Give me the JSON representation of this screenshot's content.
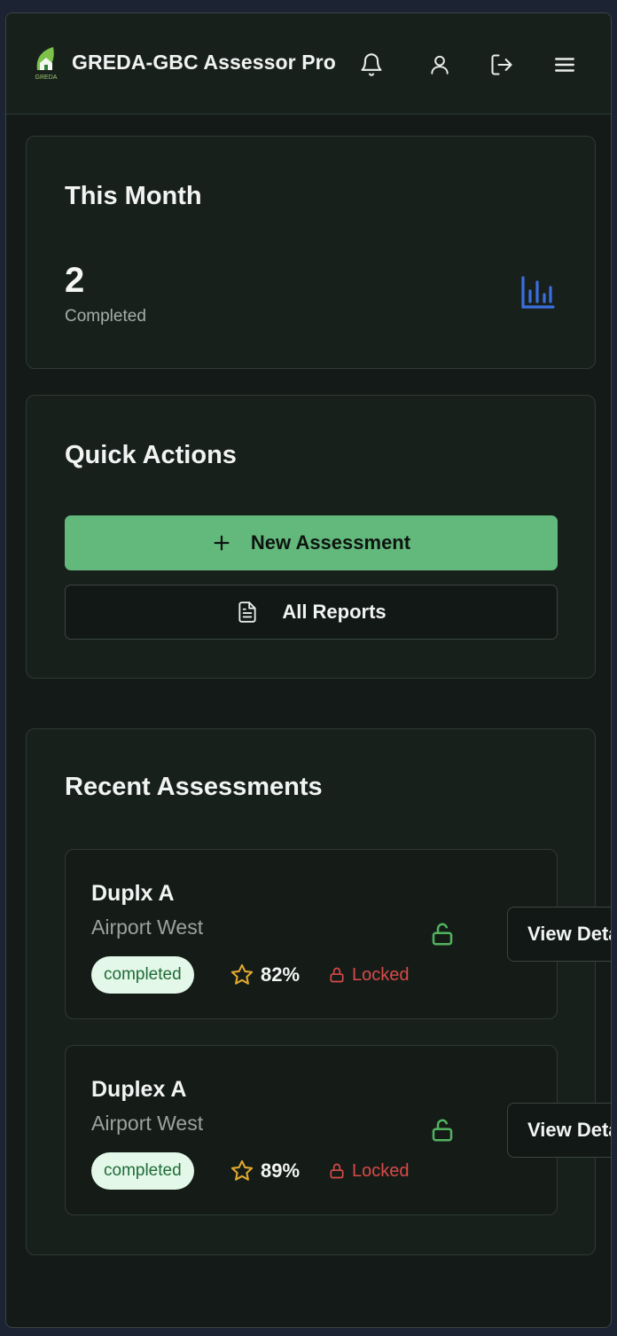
{
  "header": {
    "app_title": "GREDA-GBC Assessor Pro",
    "logo_text": "GREDA",
    "icons": [
      "bell-icon",
      "user-icon",
      "logout-icon",
      "menu-icon"
    ]
  },
  "this_month": {
    "title": "This Month",
    "value": "2",
    "label": "Completed",
    "icon": "bar-chart-icon"
  },
  "quick_actions": {
    "title": "Quick Actions",
    "new_assessment_label": "New Assessment",
    "all_reports_label": "All Reports"
  },
  "recent": {
    "title": "Recent Assessments",
    "items": [
      {
        "name": "Duplx A",
        "location": "Airport West",
        "status": "completed",
        "score": "82%",
        "lock_label": "Locked",
        "view_label": "View Details"
      },
      {
        "name": "Duplex A",
        "location": "Airport West",
        "status": "completed",
        "score": "89%",
        "lock_label": "Locked",
        "view_label": "View Details"
      }
    ]
  },
  "colors": {
    "accent_green": "#63b87c",
    "chart_blue": "#3b6fe0",
    "star_gold": "#e0a82e",
    "locked_red": "#d84a47",
    "unlock_green": "#52b35f"
  }
}
